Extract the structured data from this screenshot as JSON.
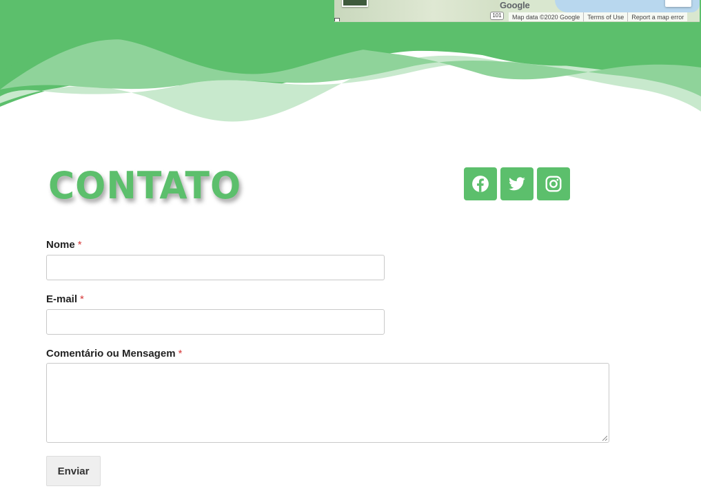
{
  "map": {
    "google_logo": "Google",
    "route_badge": "101",
    "credits": [
      "Map data ©2020 Google",
      "Terms of Use",
      "Report a map error"
    ]
  },
  "colors": {
    "brand_green": "#5cbf6c",
    "wave_mid": "#8fd39a",
    "wave_light": "#c8e9cd",
    "required": "#d63838"
  },
  "contact": {
    "title": "CONTATO"
  },
  "social": [
    {
      "name": "facebook-icon"
    },
    {
      "name": "twitter-icon"
    },
    {
      "name": "instagram-icon"
    }
  ],
  "form": {
    "name_label": "Nome",
    "email_label": "E-mail",
    "message_label": "Comentário ou Mensagem",
    "required_mark": "*",
    "name_value": "",
    "email_value": "",
    "message_value": "",
    "submit_label": "Enviar"
  }
}
